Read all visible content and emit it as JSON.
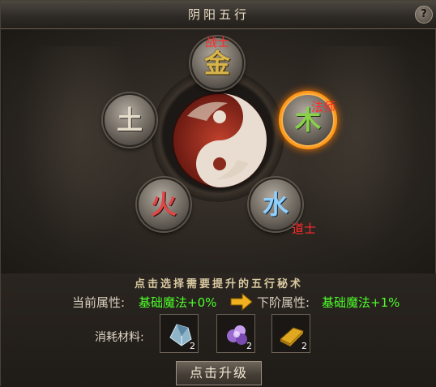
{
  "title": "阴阳五行",
  "help_label": "?",
  "elements": {
    "jin": {
      "glyph": "金",
      "class_tag": "战士"
    },
    "tu": {
      "glyph": "土"
    },
    "mu": {
      "glyph": "木",
      "class_tag": "法师",
      "selected": true
    },
    "huo": {
      "glyph": "火"
    },
    "shui": {
      "glyph": "水",
      "class_tag": "道士"
    }
  },
  "hint": "点击选择需要提升的五行秘术",
  "current": {
    "label": "当前属性:",
    "value": "基础魔法+0%"
  },
  "next": {
    "label": "下阶属性:",
    "value": "基础魔法+1%"
  },
  "materials": {
    "label": "消耗材料:",
    "items": [
      {
        "icon": "crystal-ore-icon",
        "count": "2"
      },
      {
        "icon": "purple-gem-icon",
        "count": "2"
      },
      {
        "icon": "gold-bar-icon",
        "count": "2"
      }
    ]
  },
  "upgrade_label": "点击升级",
  "colors": {
    "accent_select": "#ff9a1a",
    "attr_value": "#4cff2a",
    "class_tag": "#ff2a2a"
  }
}
